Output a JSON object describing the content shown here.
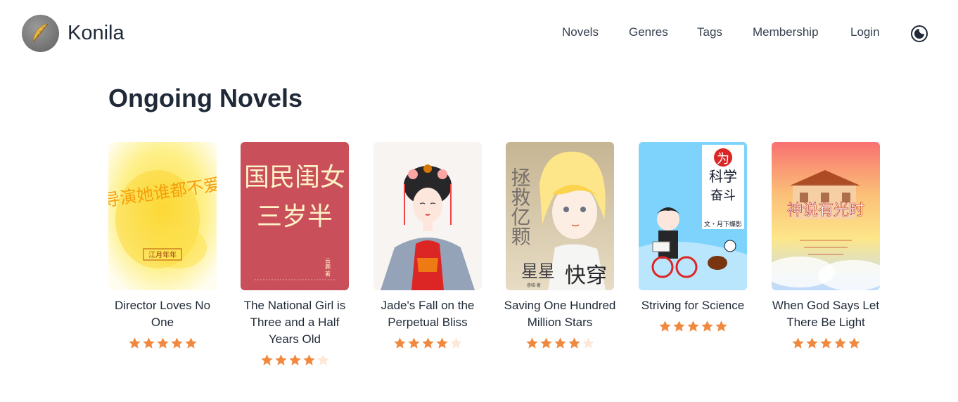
{
  "brand": {
    "name": "Konila",
    "logo_icon": "feather-icon"
  },
  "nav": [
    {
      "key": "novels",
      "label": "Novels"
    },
    {
      "key": "genres",
      "label": "Genres"
    },
    {
      "key": "tags",
      "label": "Tags"
    },
    {
      "key": "membership",
      "label": "Membership"
    },
    {
      "key": "login",
      "label": "Login"
    }
  ],
  "theme_toggle_icon": "moon-icon",
  "section": {
    "title": "Ongoing Novels"
  },
  "novels": [
    {
      "title": "Director Loves No One",
      "rating": 5,
      "cover": {
        "text": "导演她谁都不爱",
        "stamp": "江月年年",
        "palette": [
          "#fffbe0",
          "#fde047",
          "#f59e0b"
        ]
      }
    },
    {
      "title": "The National Girl is Three and a Half Years Old",
      "rating": 4,
      "cover": {
        "text_line1": "国民闺女",
        "text_line2": "三岁半",
        "author": "云鹿·著",
        "palette": [
          "#c94f5b",
          "#fef3c7"
        ]
      }
    },
    {
      "title": "Jade's Fall on the Perpetual Bliss",
      "rating": 4,
      "cover": {
        "palette": [
          "#f8f4f2",
          "#dc2626",
          "#94a3b8"
        ]
      }
    },
    {
      "title": "Saving One Hundred Million Stars",
      "rating": 4,
      "cover": {
        "text_vertical": "拯救亿颗",
        "text_bottom": "星星",
        "text_right": "快穿",
        "author": "睿喵·著",
        "palette": [
          "#d6c7a8",
          "#fde68a",
          "#3f3f46"
        ]
      }
    },
    {
      "title": "Striving for Science",
      "rating": 5,
      "cover": {
        "text_top": "为",
        "text_mid": "科学",
        "text_low": "奋斗",
        "author": "文・月下蝶影",
        "palette": [
          "#7dd3fc",
          "#ffffff",
          "#dc2626"
        ]
      }
    },
    {
      "title": "When God Says Let There Be Light",
      "rating": 5,
      "cover": {
        "text": "神说有光时",
        "palette": [
          "#f87171",
          "#fde68a",
          "#bfdbfe"
        ]
      }
    }
  ],
  "colors": {
    "star_filled": "#f0883e",
    "star_empty": "#fde7d6",
    "text": "#1f2937"
  }
}
